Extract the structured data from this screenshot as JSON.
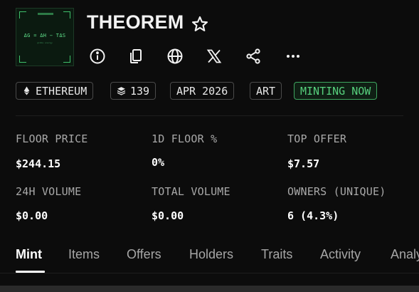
{
  "collection": {
    "name": "THEOREM",
    "thumbnail_formula": "ΔG = ΔH − TΔS",
    "thumbnail_sub": "gibbs energy"
  },
  "actions": [
    {
      "name": "info-icon"
    },
    {
      "name": "copy-icon"
    },
    {
      "name": "globe-icon"
    },
    {
      "name": "x-twitter-icon"
    },
    {
      "name": "share-icon"
    },
    {
      "name": "more-icon"
    }
  ],
  "tags": {
    "chain": "ETHEREUM",
    "items": "139",
    "date": "APR 2026",
    "category": "ART",
    "status": "MINTING NOW"
  },
  "stats": {
    "floor_price": {
      "label": "FLOOR PRICE",
      "value": "$244.15"
    },
    "floor_1d": {
      "label": "1D FLOOR %",
      "value": "0%"
    },
    "top_offer": {
      "label": "TOP OFFER",
      "value": "$7.57"
    },
    "volume_24h": {
      "label": "24H VOLUME",
      "value": "$0.00"
    },
    "total_volume": {
      "label": "TOTAL VOLUME",
      "value": "$0.00"
    },
    "owners": {
      "label": "OWNERS (UNIQUE)",
      "value": "6 (4.3%)"
    }
  },
  "tabs": [
    "Mint",
    "Items",
    "Offers",
    "Holders",
    "Traits",
    "Activity",
    "Analytics"
  ],
  "colors": {
    "accent_green": "#57d07d",
    "background": "#0c0c0c"
  }
}
